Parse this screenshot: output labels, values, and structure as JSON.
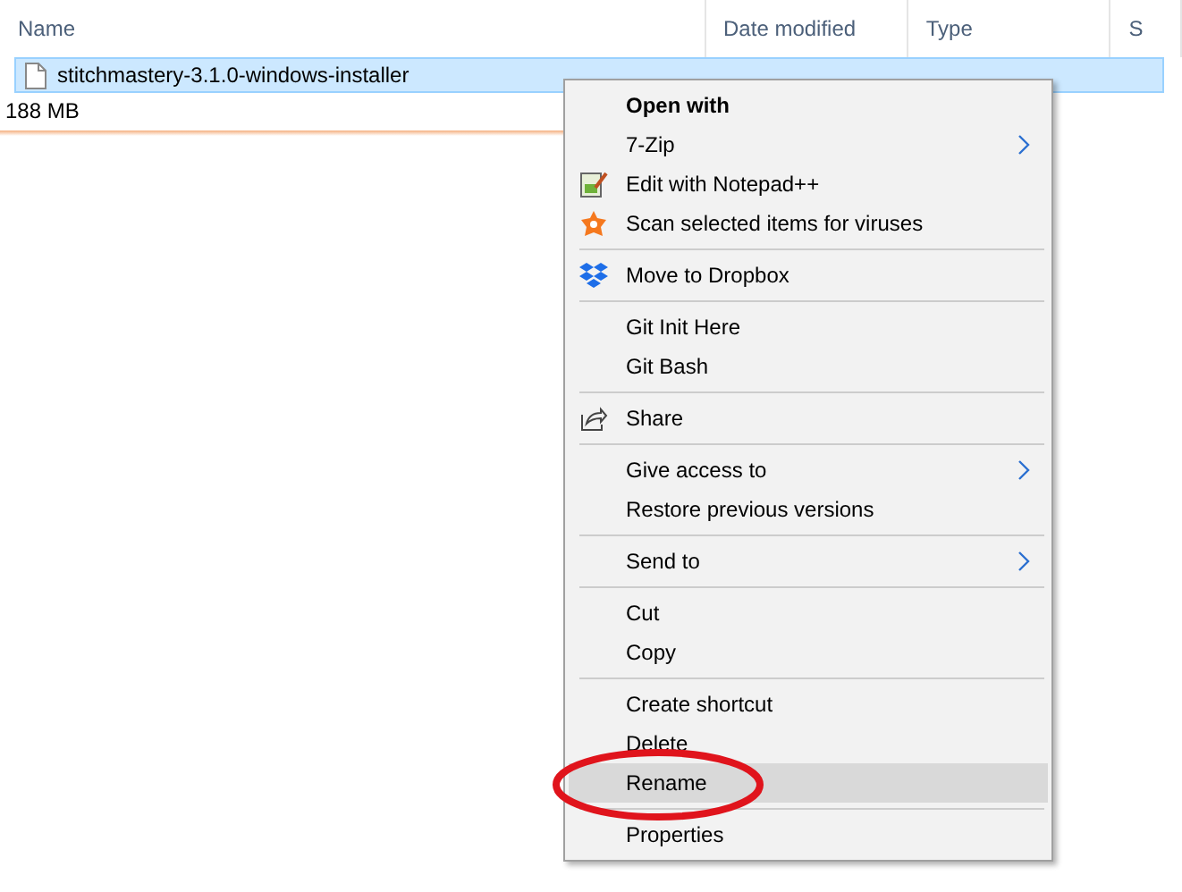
{
  "columns": [
    {
      "label": "Name"
    },
    {
      "label": "Date modified"
    },
    {
      "label": "Type"
    },
    {
      "label": "S"
    }
  ],
  "file": {
    "name": "stitchmastery-3.1.0-windows-installer",
    "selected": true
  },
  "size": "188 MB",
  "menu": [
    {
      "kind": "item",
      "label": "Open with",
      "bold": true,
      "submenu": false,
      "selected": false
    },
    {
      "kind": "item",
      "label": "7-Zip",
      "bold": false,
      "submenu": true,
      "selected": false
    },
    {
      "kind": "icon",
      "label": "Edit with Notepad++",
      "bold": false,
      "submenu": false,
      "selected": false
    },
    {
      "kind": "icon",
      "label": "Scan selected items for viruses",
      "bold": false,
      "submenu": false,
      "selected": false
    },
    {
      "kind": "separator"
    },
    {
      "kind": "icon",
      "label": "Move to Dropbox",
      "bold": false,
      "submenu": false,
      "selected": false
    },
    {
      "kind": "separator"
    },
    {
      "kind": "item",
      "label": "Git Init Here",
      "bold": false,
      "submenu": false,
      "selected": false
    },
    {
      "kind": "item",
      "label": "Git Bash",
      "bold": false,
      "submenu": false,
      "selected": false
    },
    {
      "kind": "separator"
    },
    {
      "kind": "icon",
      "label": "Share",
      "bold": false,
      "submenu": false,
      "selected": false
    },
    {
      "kind": "separator"
    },
    {
      "kind": "item",
      "label": "Give access to",
      "bold": false,
      "submenu": true,
      "selected": false
    },
    {
      "kind": "item",
      "label": "Restore previous versions",
      "bold": false,
      "submenu": false,
      "selected": false
    },
    {
      "kind": "separator"
    },
    {
      "kind": "item",
      "label": "Send to",
      "bold": false,
      "submenu": true,
      "selected": false
    },
    {
      "kind": "separator"
    },
    {
      "kind": "item",
      "label": "Cut",
      "bold": false,
      "submenu": false,
      "selected": false
    },
    {
      "kind": "item",
      "label": "Copy",
      "bold": false,
      "submenu": false,
      "selected": false
    },
    {
      "kind": "separator"
    },
    {
      "kind": "item",
      "label": "Create shortcut",
      "bold": false,
      "submenu": false,
      "selected": false
    },
    {
      "kind": "item",
      "label": "Delete",
      "bold": false,
      "submenu": false,
      "selected": false
    },
    {
      "kind": "item",
      "label": "Rename",
      "bold": false,
      "submenu": false,
      "selected": true
    },
    {
      "kind": "separator"
    },
    {
      "kind": "item",
      "label": "Properties",
      "bold": false,
      "submenu": false,
      "selected": false
    }
  ]
}
